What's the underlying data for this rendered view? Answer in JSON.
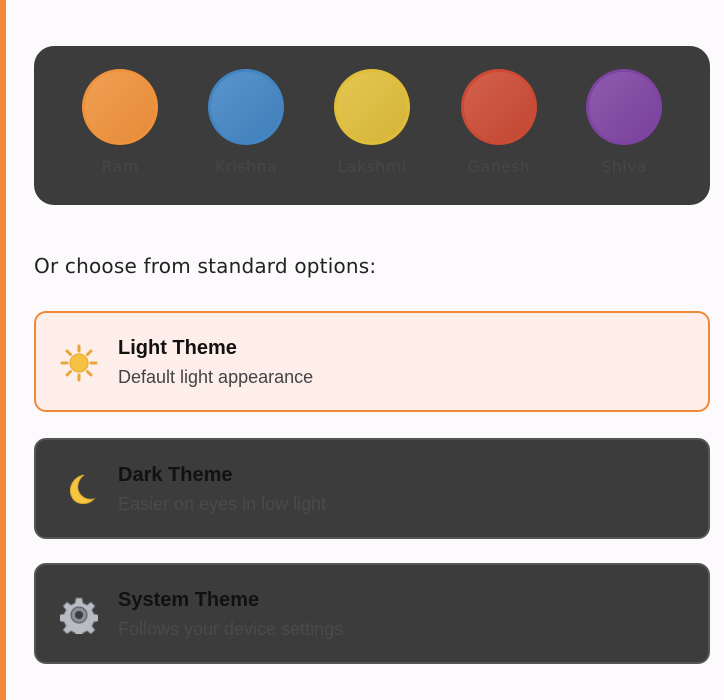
{
  "palettes": [
    {
      "name": "Ram",
      "color": "#f0923b",
      "color2": "#e8a04a"
    },
    {
      "name": "Krishna",
      "color": "#4385c4",
      "color2": "#4a8fd0"
    },
    {
      "name": "Lakshmi",
      "color": "#e0be3a",
      "color2": "#e6c444"
    },
    {
      "name": "Ganesh",
      "color": "#cc4a34",
      "color2": "#d24f38"
    },
    {
      "name": "Shiva",
      "color": "#7f44a3",
      "color2": "#8648ab"
    }
  ],
  "section_label": "Or choose from standard options:",
  "themes": [
    {
      "title": "Light Theme",
      "description": "Default light appearance",
      "icon": "sun-icon",
      "selected": true
    },
    {
      "title": "Dark Theme",
      "description": "Easier on eyes in low light",
      "icon": "moon-icon",
      "selected": false
    },
    {
      "title": "System Theme",
      "description": "Follows your device settings",
      "icon": "gear-icon",
      "selected": false
    }
  ],
  "colors": {
    "accent": "#f0883a",
    "card_dark": "#3c3c3c",
    "selected_bg": "#fdeee9"
  }
}
